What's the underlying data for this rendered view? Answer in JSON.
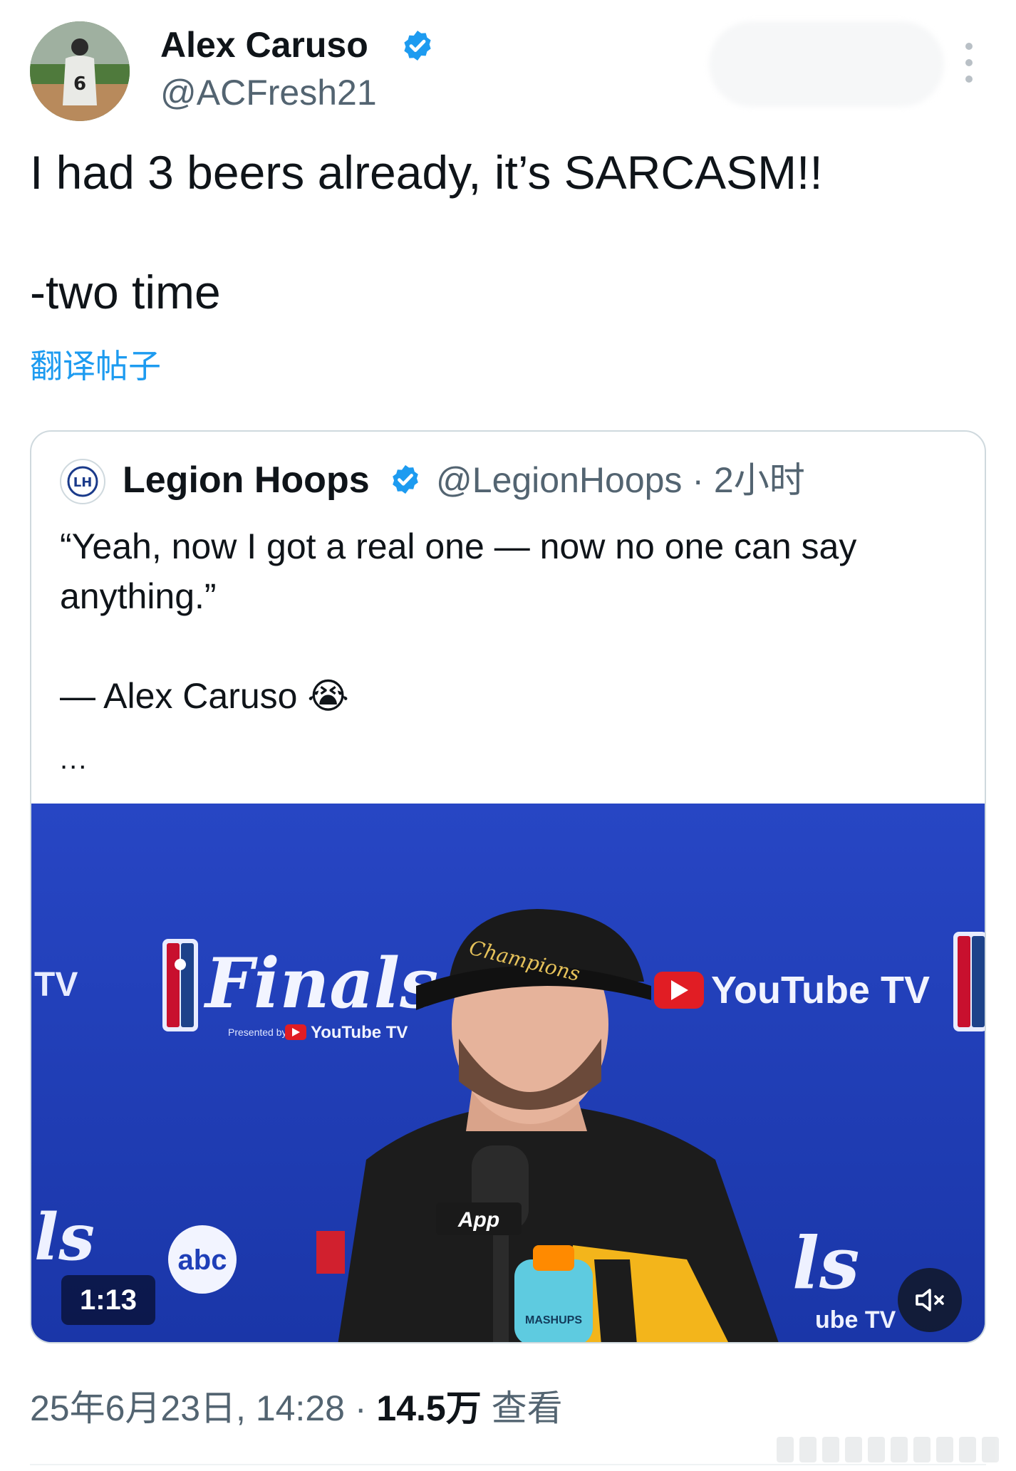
{
  "tweet": {
    "author_name": "Alex Caruso",
    "author_handle": "@ACFresh21",
    "avatar_jersey_number": "6",
    "text": "I had 3 beers already, it’s SARCASM!!\n\n-two time",
    "translate_label": "翻译帖子"
  },
  "quote": {
    "author_name": "Legion Hoops",
    "author_handle": "@LegionHoops",
    "separator": "·",
    "time": "2小时",
    "avatar_initials": "LH",
    "text": "“Yeah, now I got a real one — now no one can say anything.”\n\n— Alex Caruso 😭",
    "ellipsis": "...",
    "video": {
      "duration": "1:13",
      "backdrop_texts": {
        "finals": "Finals",
        "presented_by": "Presented by",
        "youtube_tv": "YouTube TV",
        "abc": "abc",
        "app": "App",
        "hat_text": "Champions",
        "mashups": "MASHUPS",
        "edge_tv": "TV",
        "edge_ube_tv": "ube TV",
        "edge_ls_left": "ls",
        "edge_ls_right": "ls"
      }
    }
  },
  "footer": {
    "date_time": "25年6月23日, 14:28",
    "separator": " · ",
    "views_count": "14.5万",
    "views_label": " 查看"
  },
  "colors": {
    "link_blue": "#1d9bf0",
    "verified_blue": "#1d9bf0",
    "secondary_text": "#536471",
    "court_backdrop": "#1f3fb8"
  }
}
